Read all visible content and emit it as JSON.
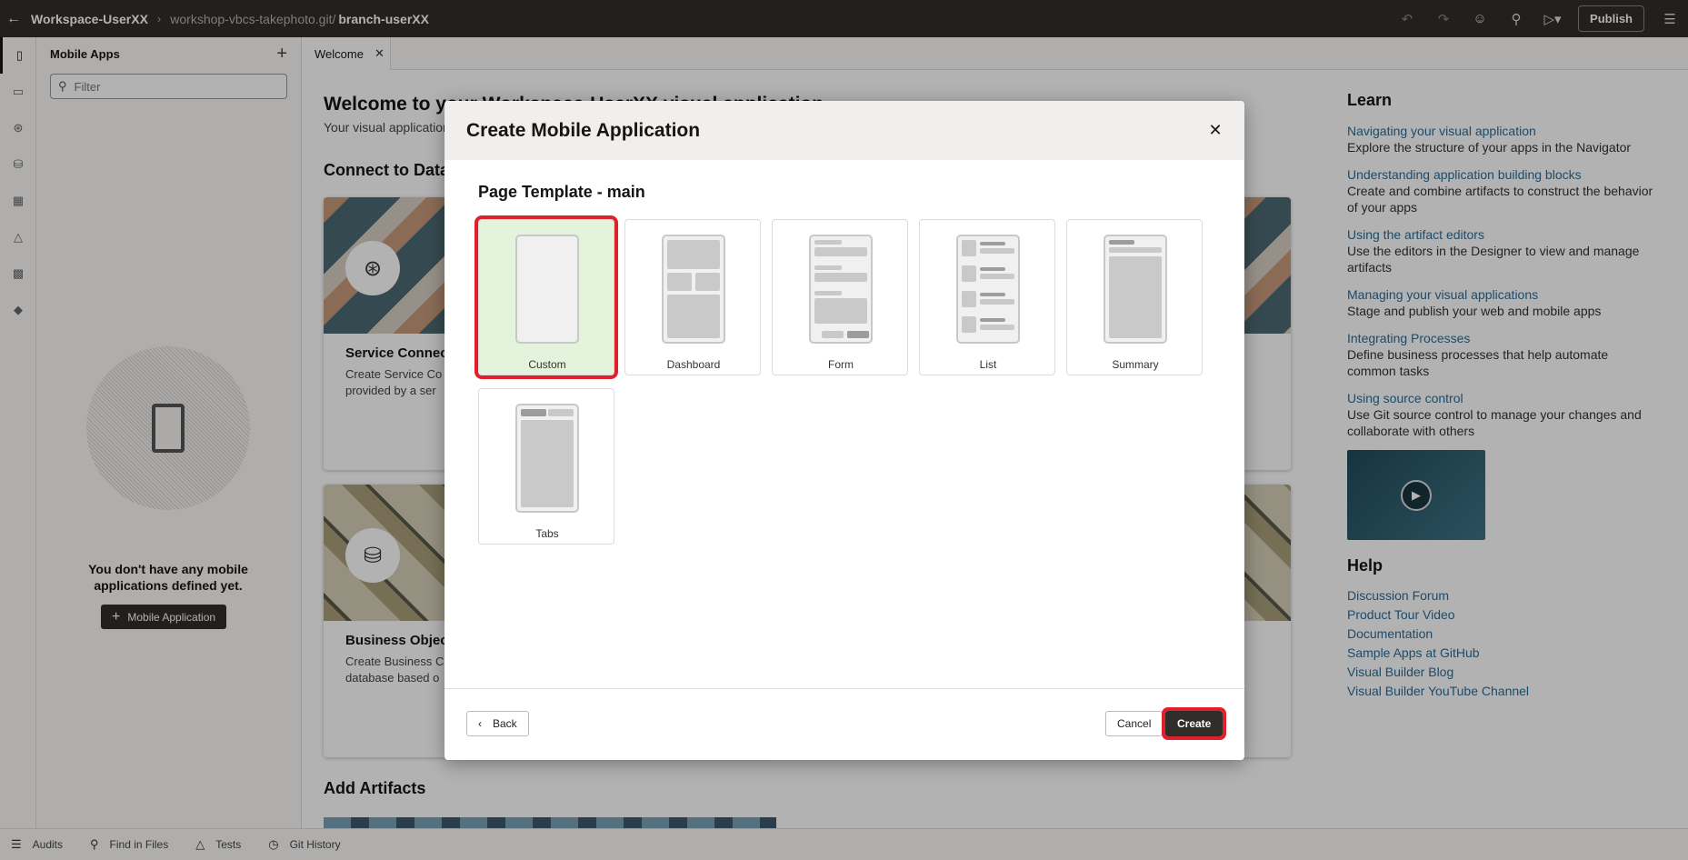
{
  "topbar": {
    "workspace": "Workspace-UserXX",
    "repo": "workshop-vbcs-takephoto.git/",
    "branch": "branch-userXX",
    "publish_label": "Publish"
  },
  "navigator": {
    "title": "Mobile Apps",
    "filter_placeholder": "Filter",
    "empty_message": "You don't have any mobile applications defined yet.",
    "add_button_label": "Mobile Application"
  },
  "tabs": [
    {
      "label": "Welcome"
    }
  ],
  "welcome": {
    "title": "Welcome to your Workspace-UserXX visual application",
    "subtitle": "Your visual application",
    "connect_heading": "Connect to Data",
    "cards": [
      {
        "title": "Service Connec",
        "desc": "Create Service Co provided by a ser"
      },
      {
        "title": "Business Objec",
        "desc": "Create Business C database based o"
      }
    ],
    "add_artifacts_heading": "Add Artifacts"
  },
  "learn": {
    "heading": "Learn",
    "items": [
      {
        "link": "Navigating your visual application",
        "desc": "Explore the structure of your apps in the Navigator"
      },
      {
        "link": "Understanding application building blocks",
        "desc": "Create and combine artifacts to construct the behavior of your apps"
      },
      {
        "link": "Using the artifact editors",
        "desc": "Use the editors in the Designer to view and manage artifacts"
      },
      {
        "link": "Managing your visual applications",
        "desc": "Stage and publish your web and mobile apps"
      },
      {
        "link": "Integrating Processes",
        "desc": "Define business processes that help automate common tasks"
      },
      {
        "link": "Using source control",
        "desc": "Use Git source control to manage your changes and collaborate with others"
      }
    ]
  },
  "help": {
    "heading": "Help",
    "links": [
      "Discussion Forum",
      "Product Tour Video",
      "Documentation",
      "Sample Apps at GitHub",
      "Visual Builder Blog",
      "Visual Builder YouTube Channel"
    ]
  },
  "statusbar": {
    "items": [
      "Audits",
      "Find in Files",
      "Tests",
      "Git History"
    ]
  },
  "dialog": {
    "title": "Create Mobile Application",
    "subtitle": "Page Template - main",
    "templates": [
      {
        "label": "Custom",
        "selected": true
      },
      {
        "label": "Dashboard",
        "selected": false
      },
      {
        "label": "Form",
        "selected": false
      },
      {
        "label": "List",
        "selected": false
      },
      {
        "label": "Summary",
        "selected": false
      },
      {
        "label": "Tabs",
        "selected": false
      }
    ],
    "back_label": "Back",
    "cancel_label": "Cancel",
    "create_label": "Create",
    "highlight_color": "#e0202a",
    "selected_bg": "#e3f3dc"
  }
}
